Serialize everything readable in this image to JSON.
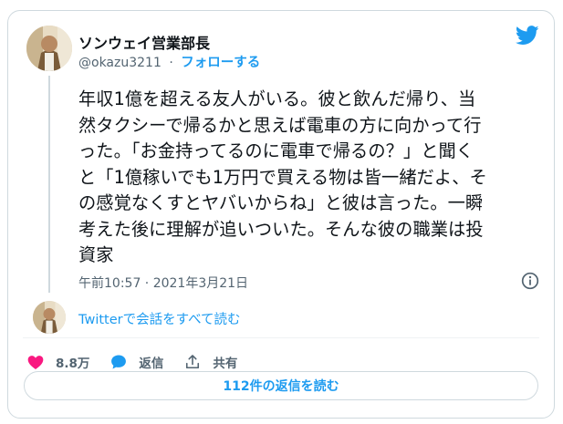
{
  "author": {
    "display_name": "ソンウェイ営業部長",
    "handle": "@okazu3211",
    "separator": "·",
    "follow_label": "フォローする"
  },
  "tweet": {
    "text": "年収1億を超える友人がいる。彼と飲んだ帰り、当\n然タクシーで帰るかと思えば電車の方に向かって行\nった。「お金持ってるのに電車で帰るの？」と聞く\nと「1億稼いでも1万円で買える物は皆一緒だよ、そ\nの感覚なくすとヤバいからね」と彼は言った。一瞬\n考えた後に理解が追いついた。そんな彼の職業は投\n資家",
    "timestamp": "午前10:57 · 2021年3月21日"
  },
  "conversation": {
    "read_label": "Twitterで会話をすべて読む"
  },
  "actions": {
    "likes": "8.8万",
    "reply_label": "返信",
    "share_label": "共有"
  },
  "replies_button": {
    "label": "112件の返信を読む"
  },
  "colors": {
    "accent": "#1d9bf0",
    "like": "#f91880",
    "text": "#0f1419",
    "muted": "#536471"
  },
  "icons": [
    "twitter-bird-icon",
    "info-icon",
    "heart-icon",
    "speech-bubble-icon",
    "share-icon"
  ]
}
